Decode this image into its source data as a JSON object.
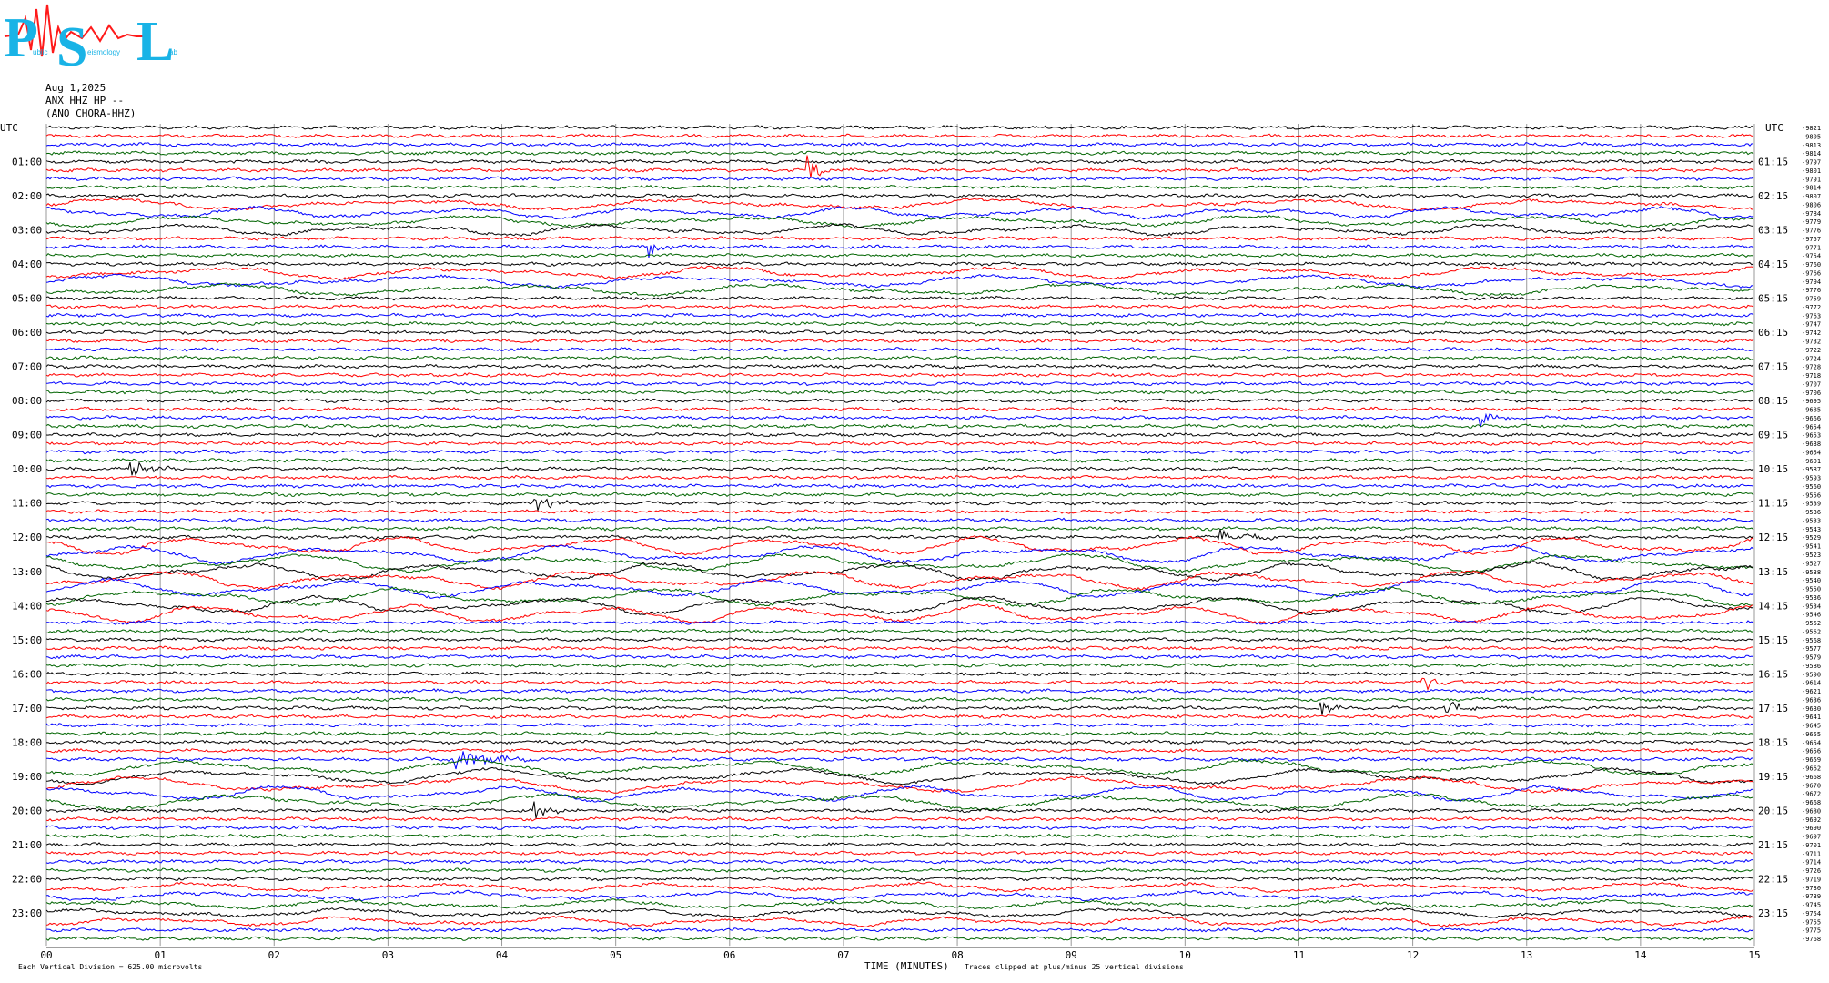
{
  "logo": {
    "big": [
      "P",
      "S",
      "L"
    ],
    "small": [
      "ublic",
      "eismology",
      "ab"
    ]
  },
  "header": {
    "date": "Aug 1,2025",
    "channel": "ANX HHZ HP --",
    "station": "(ANO CHORA-HHZ)"
  },
  "chart_data": {
    "type": "line",
    "description_free": true,
    "utc_label": "UTC",
    "left_hour_labels": [
      "01:00",
      "02:00",
      "03:00",
      "04:00",
      "05:00",
      "06:00",
      "07:00",
      "08:00",
      "09:00",
      "10:00",
      "11:00",
      "12:00",
      "13:00",
      "14:00",
      "15:00",
      "16:00",
      "17:00",
      "18:00",
      "19:00",
      "20:00",
      "21:00",
      "22:00",
      "23:00"
    ],
    "right_hour_labels": [
      "01:15",
      "02:15",
      "03:15",
      "04:15",
      "05:15",
      "06:15",
      "07:15",
      "08:15",
      "09:15",
      "10:15",
      "11:15",
      "12:15",
      "13:15",
      "14:15",
      "15:15",
      "16:15",
      "17:15",
      "18:15",
      "19:15",
      "20:15",
      "21:15",
      "22:15",
      "23:15"
    ],
    "x_ticks": [
      "00",
      "01",
      "02",
      "03",
      "04",
      "05",
      "06",
      "07",
      "08",
      "09",
      "10",
      "11",
      "12",
      "13",
      "14",
      "15"
    ],
    "xlabel": "TIME (MINUTES)",
    "xlim": [
      0,
      15
    ],
    "trace_count": 96,
    "trace_minutes": 15,
    "trace_colors": [
      "#000000",
      "#ff0000",
      "#0000ff",
      "#006400"
    ],
    "offsets": [
      "-9821",
      "-9805",
      "-9813",
      "-9814",
      "-9797",
      "-9801",
      "-9791",
      "-9814",
      "-9807",
      "-9806",
      "-9784",
      "-9779",
      "-9776",
      "-9757",
      "-9771",
      "-9754",
      "-9760",
      "-9766",
      "-9794",
      "-9776",
      "-9759",
      "-9772",
      "-9763",
      "-9747",
      "-9742",
      "-9732",
      "-9722",
      "-9724",
      "-9728",
      "-9718",
      "-9707",
      "-9706",
      "-9695",
      "-9685",
      "-9666",
      "-9654",
      "-9653",
      "-9638",
      "-9654",
      "-9601",
      "-9587",
      "-9593",
      "-9560",
      "-9556",
      "-9539",
      "-9536",
      "-9533",
      "-9543",
      "-9529",
      "-9541",
      "-9523",
      "-9527",
      "-9538",
      "-9540",
      "-9550",
      "-9536",
      "-9534",
      "-9546",
      "-9552",
      "-9562",
      "-9568",
      "-9577",
      "-9579",
      "-9586",
      "-9590",
      "-9614",
      "-9621",
      "-9636",
      "-9630",
      "-9641",
      "-9645",
      "-9655",
      "-9654",
      "-9656",
      "-9659",
      "-9662",
      "-9668",
      "-9670",
      "-9672",
      "-9668",
      "-9680",
      "-9692",
      "-9690",
      "-9697",
      "-9701",
      "-9711",
      "-9714",
      "-9726",
      "-9719",
      "-9730",
      "-9739",
      "-9745",
      "-9754",
      "-9755",
      "-9775",
      "-9768",
      "-9769",
      "-9768"
    ],
    "events": [
      {
        "trace": 5,
        "minute": 6.7,
        "amp": 2.2,
        "len": 0.35
      },
      {
        "trace": 14,
        "minute": 5.3,
        "amp": 1.6,
        "len": 0.4
      },
      {
        "trace": 34,
        "minute": 12.6,
        "amp": 1.8,
        "len": 0.4
      },
      {
        "trace": 40,
        "minute": 0.75,
        "amp": 1.8,
        "len": 0.6
      },
      {
        "trace": 44,
        "minute": 4.3,
        "amp": 1.8,
        "len": 0.5
      },
      {
        "trace": 48,
        "minute": 10.3,
        "amp": 1.4,
        "len": 0.8
      },
      {
        "trace": 65,
        "minute": 12.1,
        "amp": 1.8,
        "len": 0.4
      },
      {
        "trace": 68,
        "minute": 11.2,
        "amp": 1.2,
        "len": 0.5
      },
      {
        "trace": 68,
        "minute": 12.3,
        "amp": 1.3,
        "len": 0.5
      },
      {
        "trace": 74,
        "minute": 3.6,
        "amp": 1.6,
        "len": 1.2
      },
      {
        "trace": 80,
        "minute": 4.3,
        "amp": 1.8,
        "len": 0.4
      }
    ],
    "wavy_bands": [
      {
        "from": 9,
        "to": 12,
        "amp": 1.2
      },
      {
        "from": 17,
        "to": 19,
        "amp": 1.3
      },
      {
        "from": 49,
        "to": 57,
        "amp": 2.0
      },
      {
        "from": 75,
        "to": 79,
        "amp": 1.7
      },
      {
        "from": 89,
        "to": 93,
        "amp": 0.9
      }
    ],
    "footer_left": "Each Vertical Division =  625.00 microvolts",
    "footer_right": "Traces clipped at plus/minus 25 vertical divisions"
  }
}
